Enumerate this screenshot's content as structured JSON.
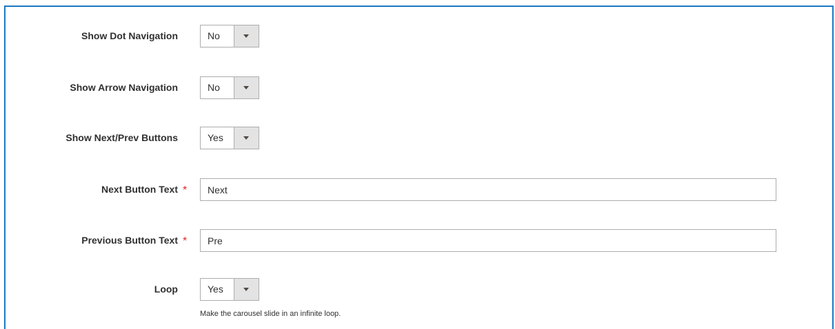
{
  "fields": {
    "dot_navigation": {
      "label": "Show Dot Navigation",
      "value": "No"
    },
    "arrow_navigation": {
      "label": "Show Arrow Navigation",
      "value": "No"
    },
    "next_prev_buttons": {
      "label": "Show Next/Prev Buttons",
      "value": "Yes"
    },
    "next_button_text": {
      "label": "Next Button Text",
      "required_mark": "*",
      "value": "Next"
    },
    "previous_button_text": {
      "label": "Previous Button Text",
      "required_mark": "*",
      "value": "Pre"
    },
    "loop": {
      "label": "Loop",
      "value": "Yes",
      "note": "Make the carousel slide in an infinite loop."
    }
  },
  "colors": {
    "frame_border": "#1979c3",
    "required": "#e22626",
    "select_arrow_bg": "#e3e3e3"
  },
  "icons": {
    "select_arrow": "triangle-down"
  }
}
